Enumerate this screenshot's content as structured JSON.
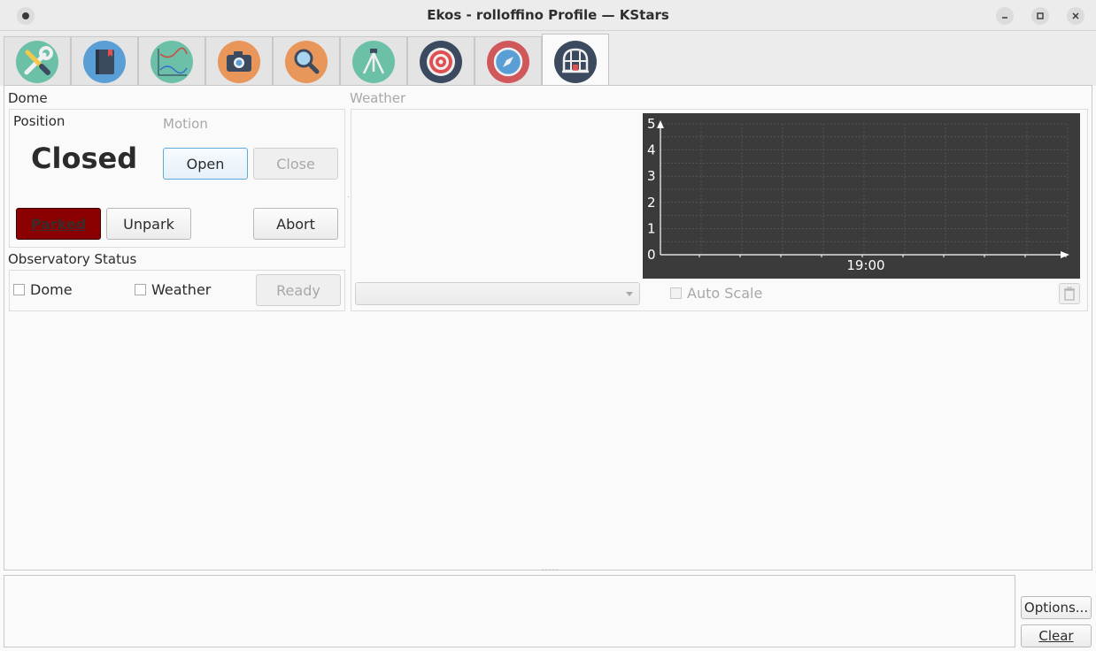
{
  "window": {
    "title": "Ekos - rolloffino Profile — KStars"
  },
  "tabs": [
    {
      "name": "setup",
      "icon": "wrench-screwdriver-icon",
      "color": "#6cc0a8"
    },
    {
      "name": "scheduler",
      "icon": "notebook-icon",
      "color": "#5a9ed6"
    },
    {
      "name": "analyze",
      "icon": "chart-icon",
      "color": "#6cc0a8"
    },
    {
      "name": "capture",
      "icon": "camera-icon",
      "color": "#e8965a"
    },
    {
      "name": "focus",
      "icon": "magnifier-icon",
      "color": "#e8965a"
    },
    {
      "name": "mount",
      "icon": "tripod-icon",
      "color": "#6cc0a8"
    },
    {
      "name": "align",
      "icon": "target-icon",
      "color": "#3b4a5e"
    },
    {
      "name": "guide",
      "icon": "compass-icon",
      "color": "#d0585a"
    },
    {
      "name": "observatory",
      "icon": "dome-icon",
      "color": "#3b4a5e",
      "active": true
    }
  ],
  "dome": {
    "section_label": "Dome",
    "position_label": "Position",
    "motion_label": "Motion",
    "status": "Closed",
    "open_button": "Open",
    "close_button": "Close",
    "parked_button": "Parked",
    "unpark_button": "Unpark",
    "abort_button": "Abort"
  },
  "observatory_status": {
    "section_label": "Observatory Status",
    "dome_checkbox": "Dome",
    "dome_checked": false,
    "weather_checkbox": "Weather",
    "weather_checked": false,
    "ready_button": "Ready"
  },
  "weather": {
    "section_label": "Weather",
    "auto_scale_label": "Auto Scale",
    "auto_scale_checked": false,
    "sensor_select_value": ""
  },
  "chart_data": {
    "type": "line",
    "title": "",
    "xlabel": "",
    "ylabel": "",
    "ylim": [
      0,
      5
    ],
    "y_ticks": [
      "0",
      "1",
      "2",
      "3",
      "4",
      "5"
    ],
    "x_ticks": [
      "19:00"
    ],
    "series": [],
    "grid": true,
    "background": "#3b3b3b"
  },
  "log": {
    "options_button": "Options...",
    "clear_button": "Clear"
  }
}
